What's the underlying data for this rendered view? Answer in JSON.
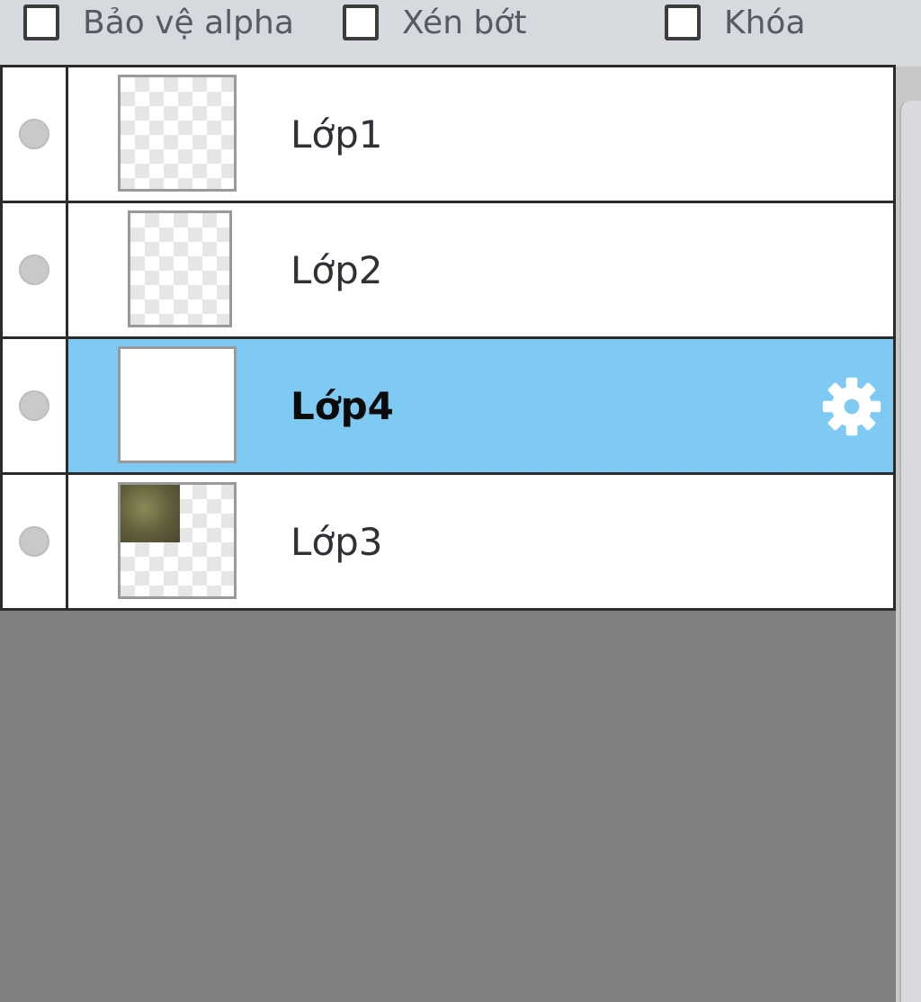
{
  "options": [
    {
      "label": "Bảo vệ alpha",
      "checked": false
    },
    {
      "label": "Xén bớt",
      "checked": false
    },
    {
      "label": "Khóa",
      "checked": false
    }
  ],
  "layers": [
    {
      "name": "Lớp1",
      "selected": false,
      "visible": false,
      "thumbnail": "transparent"
    },
    {
      "name": "Lớp2",
      "selected": false,
      "visible": false,
      "thumbnail": "transparent"
    },
    {
      "name": "Lớp4",
      "selected": true,
      "visible": false,
      "thumbnail": "white"
    },
    {
      "name": "Lớp3",
      "selected": false,
      "visible": false,
      "thumbnail": "image-patch"
    }
  ],
  "icons": {
    "visibility": "circle-dot-icon",
    "layer_settings": "gear-icon"
  },
  "colors": {
    "selected_row": "#7fcaf3",
    "panel_background": "#808080",
    "toolbar_background": "#d6d9de"
  }
}
